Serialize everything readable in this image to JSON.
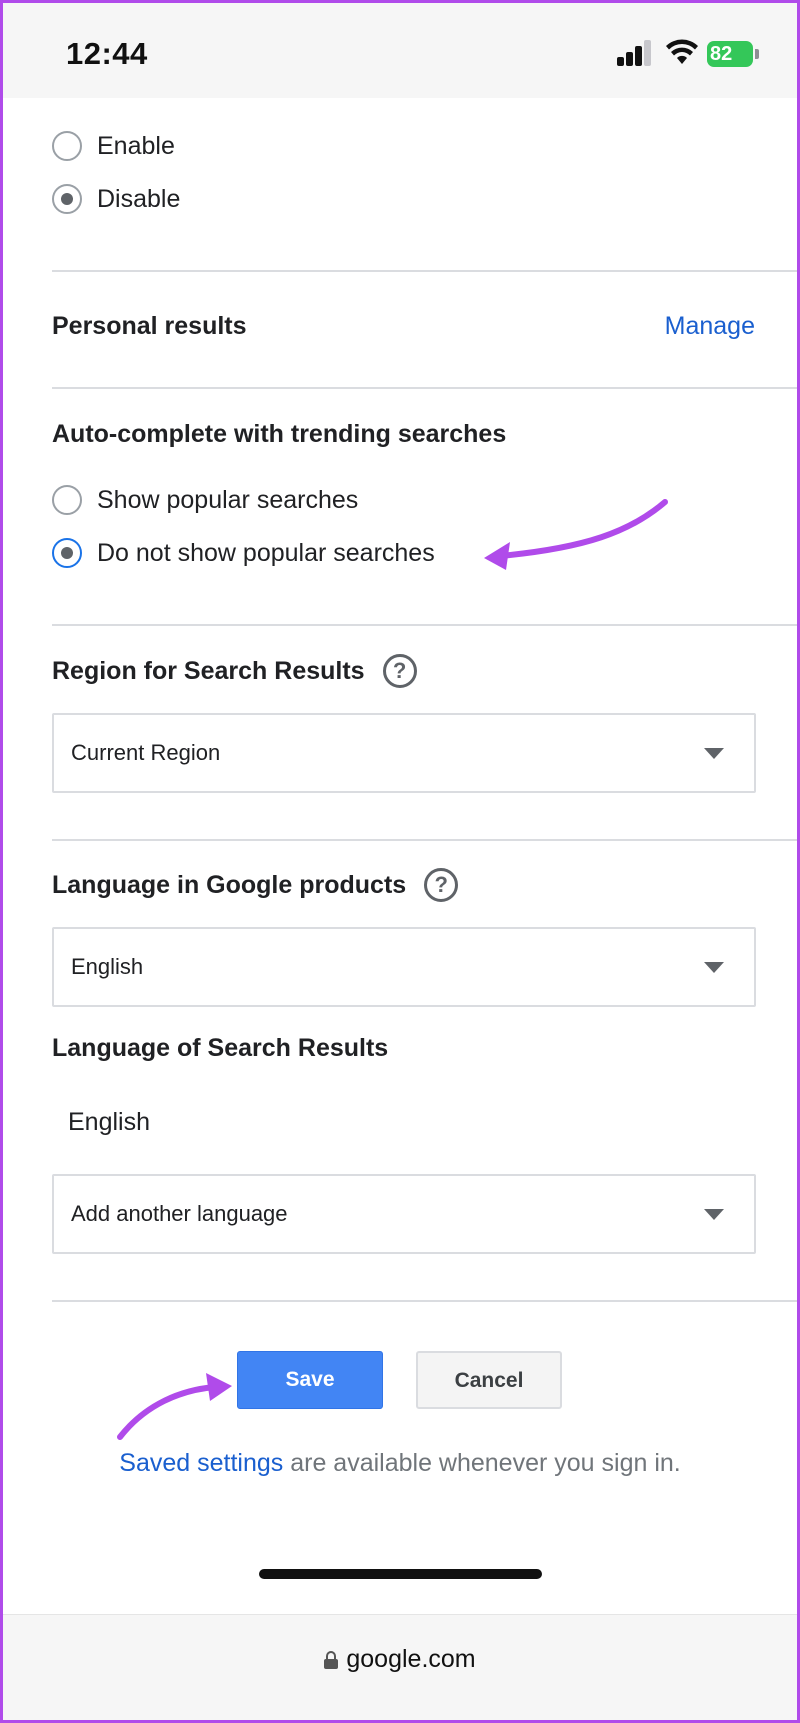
{
  "status": {
    "time": "12:44",
    "battery": "82"
  },
  "suggestions": {
    "options": [
      "Enable",
      "Disable"
    ],
    "selected_index": 1
  },
  "personal_results": {
    "title": "Personal results",
    "link": "Manage"
  },
  "autocomplete": {
    "title": "Auto-complete with trending searches",
    "options": [
      "Show popular searches",
      "Do not show popular searches"
    ],
    "selected_index": 1
  },
  "region": {
    "title": "Region for Search Results",
    "selected": "Current Region"
  },
  "language_products": {
    "title": "Language in Google products",
    "selected": "English"
  },
  "language_results": {
    "title": "Language of Search Results",
    "current": "English",
    "add_placeholder": "Add another language"
  },
  "actions": {
    "save_label": "Save",
    "cancel_label": "Cancel"
  },
  "note": {
    "link_text": "Saved settings",
    "rest_text": " are available whenever you sign in."
  },
  "browser": {
    "url": "google.com"
  },
  "colors": {
    "accent_link": "#1a5fcf",
    "save_button": "#4285f4",
    "annotation_arrow": "#b04bea"
  }
}
